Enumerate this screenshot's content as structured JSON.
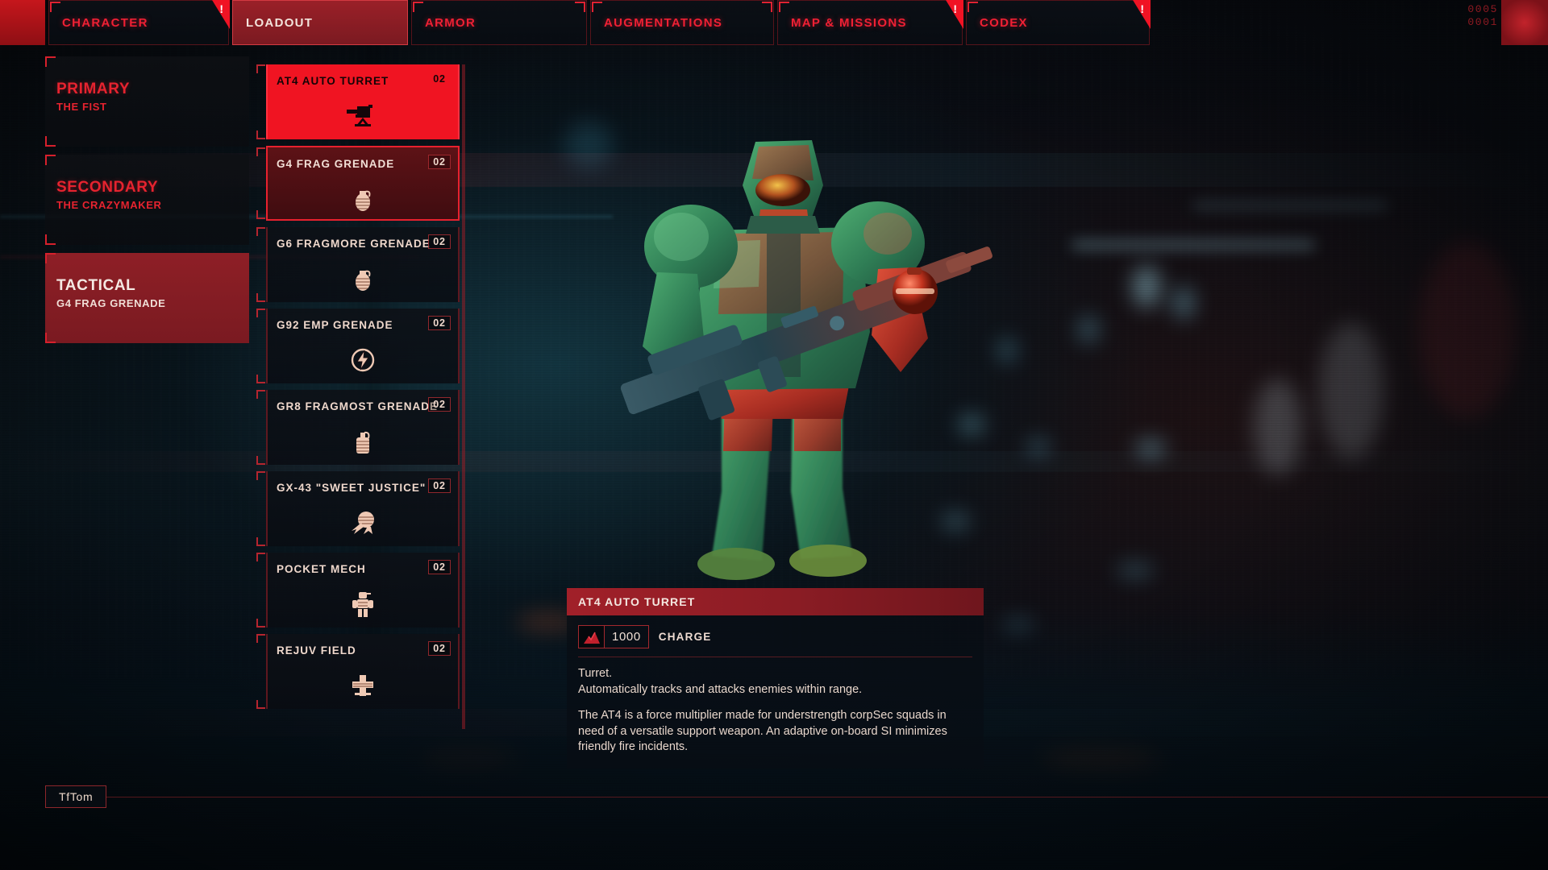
{
  "topnav": {
    "tabs": [
      {
        "label": "CHARACTER",
        "active": false,
        "notification": true,
        "notification_mark": "!"
      },
      {
        "label": "LOADOUT",
        "active": true,
        "notification": false,
        "notification_mark": ""
      },
      {
        "label": "ARMOR",
        "active": false,
        "notification": false,
        "notification_mark": ""
      },
      {
        "label": "AUGMENTATIONS",
        "active": false,
        "notification": false,
        "notification_mark": ""
      },
      {
        "label": "MAP & MISSIONS",
        "active": false,
        "notification": true,
        "notification_mark": "!"
      },
      {
        "label": "CODEX",
        "active": false,
        "notification": true,
        "notification_mark": "!"
      }
    ],
    "counter_top": "0005",
    "counter_bottom": "0001"
  },
  "slots": [
    {
      "title": "PRIMARY",
      "equipped": "THE FIST",
      "active": false
    },
    {
      "title": "SECONDARY",
      "equipped": "THE CRAZYMAKER",
      "active": false
    },
    {
      "title": "TACTICAL",
      "equipped": "G4 FRAG GRENADE",
      "active": true
    }
  ],
  "item_list": [
    {
      "name": "AT4 AUTO TURRET",
      "qty": "02",
      "icon": "turret-icon",
      "state": "selected"
    },
    {
      "name": "G4 FRAG GRENADE",
      "qty": "02",
      "icon": "grenade-icon",
      "state": "equipped"
    },
    {
      "name": "G6 FRAGMORE GRENADE",
      "qty": "02",
      "icon": "grenade-icon",
      "state": "normal"
    },
    {
      "name": "G92 EMP GRENADE",
      "qty": "02",
      "icon": "emp-bolt-icon",
      "state": "normal"
    },
    {
      "name": "GR8 FRAGMOST GRENADE",
      "qty": "02",
      "icon": "canister-icon",
      "state": "normal"
    },
    {
      "name": "GX-43 \"SWEET JUSTICE\"",
      "qty": "02",
      "icon": "shock-burst-icon",
      "state": "normal"
    },
    {
      "name": "POCKET MECH",
      "qty": "02",
      "icon": "mech-icon",
      "state": "normal"
    },
    {
      "name": "REJUV FIELD",
      "qty": "02",
      "icon": "medcross-icon",
      "state": "normal"
    }
  ],
  "detail": {
    "title": "AT4 AUTO TURRET",
    "stat_icon": "charge-icon",
    "stat_value": "1000",
    "stat_label": "CHARGE",
    "summary": "Turret.\nAutomatically tracks and attacks enemies within range.",
    "lore": "The AT4 is a force multiplier made for understrength corpSec squads in need of a versatile support weapon. An adaptive on-board SI minimizes friendly fire incidents."
  },
  "player": {
    "name": "TfTom"
  },
  "colors": {
    "accent_red": "#e6232f",
    "selected_red": "#f01422",
    "equipped_red": "#5d1216",
    "text_warm": "#efd8cc",
    "panel_dark": "#0b1016"
  }
}
